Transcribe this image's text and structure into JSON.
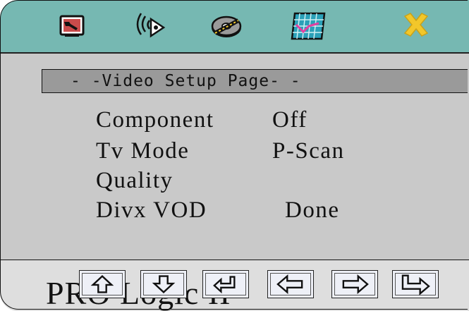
{
  "tabs": [
    {
      "icon": "tools-icon",
      "label": ""
    },
    {
      "icon": "audio-signal-icon",
      "label": ""
    },
    {
      "icon": "video-disc-icon",
      "label": ""
    },
    {
      "icon": "chart-grid-icon",
      "label": ""
    },
    {
      "icon": "close-x-icon",
      "label": ""
    }
  ],
  "page": {
    "title": "- -Video Setup Page- -"
  },
  "menu": {
    "items": [
      {
        "label": "Component",
        "value": "Off"
      },
      {
        "label": "Tv Mode",
        "value": "P-Scan"
      },
      {
        "label": "Quality",
        "value": ""
      },
      {
        "label": "Divx VOD",
        "value": "Done"
      }
    ]
  },
  "footer": {
    "text": "PRO Logic II",
    "buttons": [
      {
        "icon": "arrow-up-icon"
      },
      {
        "icon": "arrow-down-icon"
      },
      {
        "icon": "enter-icon"
      },
      {
        "icon": "arrow-left-icon"
      },
      {
        "icon": "arrow-right-icon"
      },
      {
        "icon": "return-right-icon"
      }
    ]
  },
  "colors": {
    "top_bar": "#76b8b2",
    "body": "#c9c9c9",
    "header_bar": "#9a9a9a",
    "footer_bar": "#dedede",
    "accent_yellow": "#f2c72a",
    "accent_magenta": "#e23fa0"
  }
}
